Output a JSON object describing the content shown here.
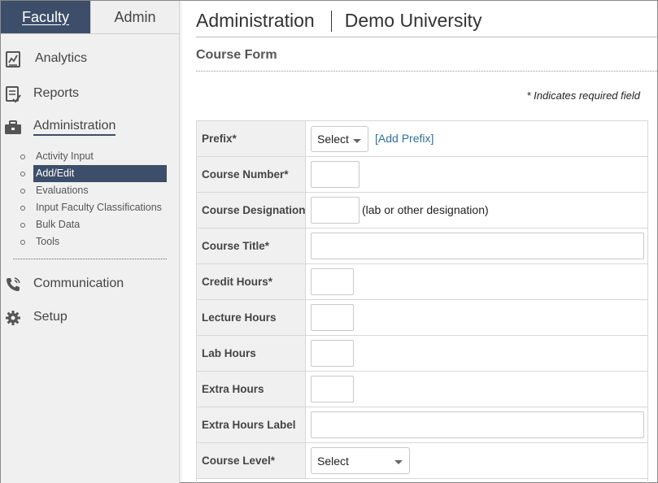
{
  "sidebar": {
    "tabs": [
      {
        "label": "Faculty",
        "active": true
      },
      {
        "label": "Admin",
        "active": false
      }
    ],
    "nav": {
      "analytics": "Analytics",
      "reports": "Reports",
      "administration": "Administration",
      "communication": "Communication",
      "setup": "Setup"
    },
    "subnav": [
      {
        "label": "Activity Input",
        "active": false
      },
      {
        "label": "Add/Edit",
        "active": true
      },
      {
        "label": "Evaluations",
        "active": false
      },
      {
        "label": "Input Faculty Classifications",
        "active": false
      },
      {
        "label": "Bulk Data",
        "active": false
      },
      {
        "label": "Tools",
        "active": false
      }
    ]
  },
  "header": {
    "section": "Administration",
    "institution": "Demo University"
  },
  "page": {
    "title": "Course Form",
    "required_note": "* Indicates required field"
  },
  "form": {
    "rows": [
      {
        "label": "Prefix*",
        "select_value": "Select",
        "link": "[Add Prefix]"
      },
      {
        "label": "Course Number*",
        "value": ""
      },
      {
        "label": "Course Designation",
        "value": "",
        "hint": "(lab or other designation)"
      },
      {
        "label": "Course Title*",
        "value": ""
      },
      {
        "label": "Credit Hours*",
        "value": ""
      },
      {
        "label": "Lecture Hours",
        "value": ""
      },
      {
        "label": "Lab Hours",
        "value": ""
      },
      {
        "label": "Extra Hours",
        "value": ""
      },
      {
        "label": "Extra Hours Label",
        "value": ""
      },
      {
        "label": "Course Level*",
        "select_value": "Select"
      }
    ]
  },
  "colors": {
    "accent": "#3d4e6a",
    "link": "#2f6ea0",
    "sidebar_bg": "#f0f0f0"
  },
  "icons": {
    "analytics": "analytics-chart-icon",
    "reports": "reports-document-icon",
    "administration": "briefcase-icon",
    "communication": "phone-icon",
    "setup": "gear-icon"
  }
}
